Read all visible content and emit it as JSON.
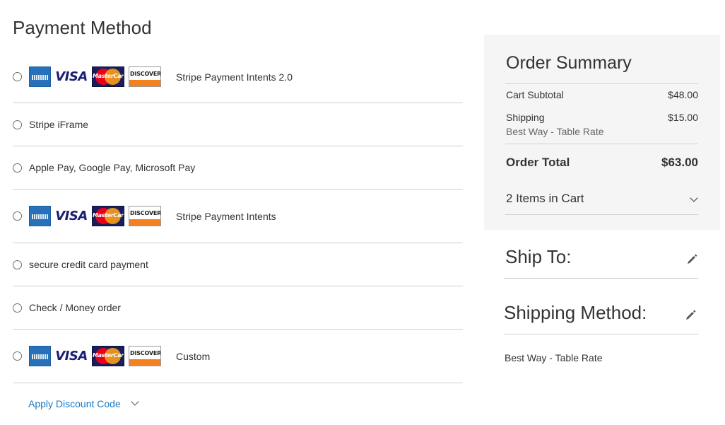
{
  "payment": {
    "title": "Payment Method",
    "methods": [
      {
        "label": "Stripe Payment Intents 2.0",
        "cards": true
      },
      {
        "label": "Stripe iFrame",
        "cards": false
      },
      {
        "label": "Apple Pay, Google Pay, Microsoft Pay",
        "cards": false
      },
      {
        "label": "Stripe Payment Intents",
        "cards": true
      },
      {
        "label": "secure credit card payment",
        "cards": false
      },
      {
        "label": "Check / Money order",
        "cards": false
      },
      {
        "label": "Custom",
        "cards": true
      }
    ],
    "card_icons": [
      "amex-card-icon",
      "visa-card-icon",
      "mastercard-card-icon",
      "discover-card-icon"
    ],
    "card_text": {
      "visa": "VISA",
      "mastercard": "MasterCard",
      "discover": "DISCOVER"
    },
    "discount_label": "Apply Discount Code"
  },
  "summary": {
    "title": "Order Summary",
    "subtotal_label": "Cart Subtotal",
    "subtotal_value": "$48.00",
    "shipping_label": "Shipping",
    "shipping_value": "$15.00",
    "shipping_method": "Best Way - Table Rate",
    "total_label": "Order Total",
    "total_value": "$63.00",
    "items_in_cart": "2 Items in Cart"
  },
  "ship_to": {
    "title": "Ship To:"
  },
  "shipping_method": {
    "title": "Shipping Method:",
    "value": "Best Way - Table Rate"
  },
  "colors": {
    "link": "#1979c3",
    "summary_bg": "#f5f5f5",
    "divider": "#cccccc"
  }
}
